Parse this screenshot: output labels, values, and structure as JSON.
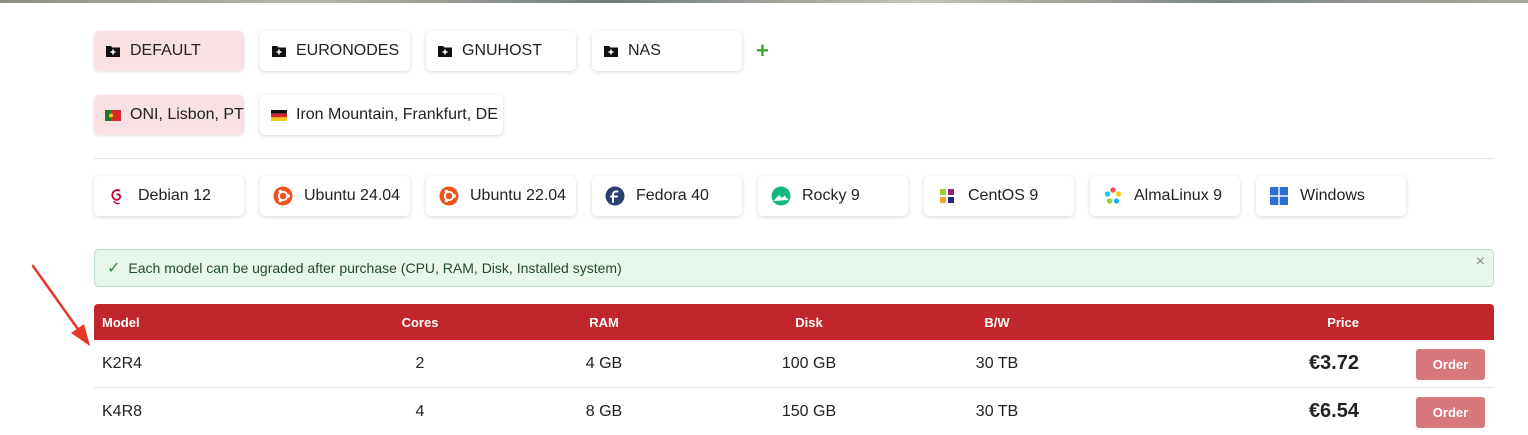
{
  "groups": [
    {
      "label": "DEFAULT",
      "icon": "folder-plus-icon",
      "active": true
    },
    {
      "label": "EURONODES",
      "icon": "folder-plus-icon",
      "active": false
    },
    {
      "label": "GNUHOST",
      "icon": "folder-plus-icon",
      "active": false
    },
    {
      "label": "NAS",
      "icon": "folder-plus-icon",
      "active": false
    }
  ],
  "add_group_label": "+",
  "locations": [
    {
      "label": "ONI, Lisbon, PT",
      "icon": "portugal-flag-icon",
      "active": true
    },
    {
      "label": "Iron Mountain, Frankfurt, DE",
      "icon": "germany-flag-icon",
      "active": false
    }
  ],
  "os_options": [
    {
      "label": "Debian 12",
      "icon": "debian-icon"
    },
    {
      "label": "Ubuntu 24.04",
      "icon": "ubuntu-icon"
    },
    {
      "label": "Ubuntu 22.04",
      "icon": "ubuntu-icon"
    },
    {
      "label": "Fedora 40",
      "icon": "fedora-icon"
    },
    {
      "label": "Rocky 9",
      "icon": "rocky-icon"
    },
    {
      "label": "CentOS 9",
      "icon": "centos-icon"
    },
    {
      "label": "AlmaLinux 9",
      "icon": "almalinux-icon"
    },
    {
      "label": "Windows",
      "icon": "windows-icon"
    }
  ],
  "notice": {
    "check": "✓",
    "text": "Each model can be ugraded after purchase (CPU, RAM, Disk, Installed system)",
    "close": "×"
  },
  "table": {
    "headers": {
      "model": "Model",
      "cores": "Cores",
      "ram": "RAM",
      "disk": "Disk",
      "bw": "B/W",
      "price": "Price"
    },
    "rows": [
      {
        "model": "K2R4",
        "cores": "2",
        "ram": "4 GB",
        "disk": "100 GB",
        "bw": "30 TB",
        "price": "€3.72",
        "action": "Order"
      },
      {
        "model": "K4R8",
        "cores": "4",
        "ram": "8 GB",
        "disk": "150 GB",
        "bw": "30 TB",
        "price": "€6.54",
        "action": "Order"
      }
    ]
  },
  "colors": {
    "table_header": "#c0262b",
    "order_button": "#d9787a",
    "active_chip": "#f8e0e3",
    "notice_bg": "#e9f6ec",
    "annotation_arrow": "#e8372a"
  }
}
